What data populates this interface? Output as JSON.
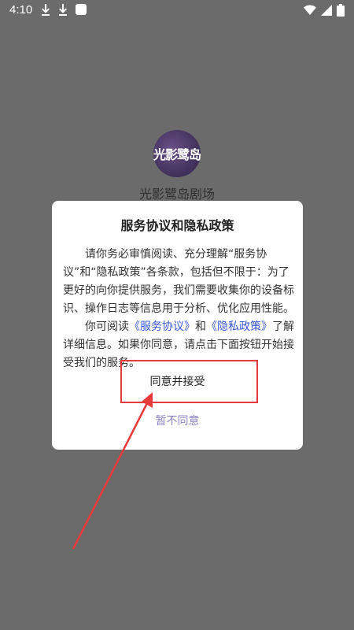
{
  "status_bar": {
    "time": "4:10"
  },
  "app": {
    "logo_text": "光影鹭岛",
    "name": "光影鹭岛剧场"
  },
  "dialog": {
    "title": "服务协议和隐私政策",
    "para1": "请你务必审慎阅读、充分理解“服务协议”和“隐私政策”各条款，包括但不限于：为了更好的向你提供服务，我们需要收集你的设备标识、操作日志等信息用于分析、优化应用性能。",
    "para2_prefix": "你可阅读",
    "service_link": "《服务协议》",
    "para2_and": "和",
    "privacy_link": "《隐私政策》",
    "para2_suffix": "了解详细信息。如果你同意，请点击下面按钮开始接受我们的服务。",
    "agree_label": "同意并接受",
    "disagree_label": "暂不同意"
  },
  "annotation": {
    "color": "#e83a3a"
  }
}
